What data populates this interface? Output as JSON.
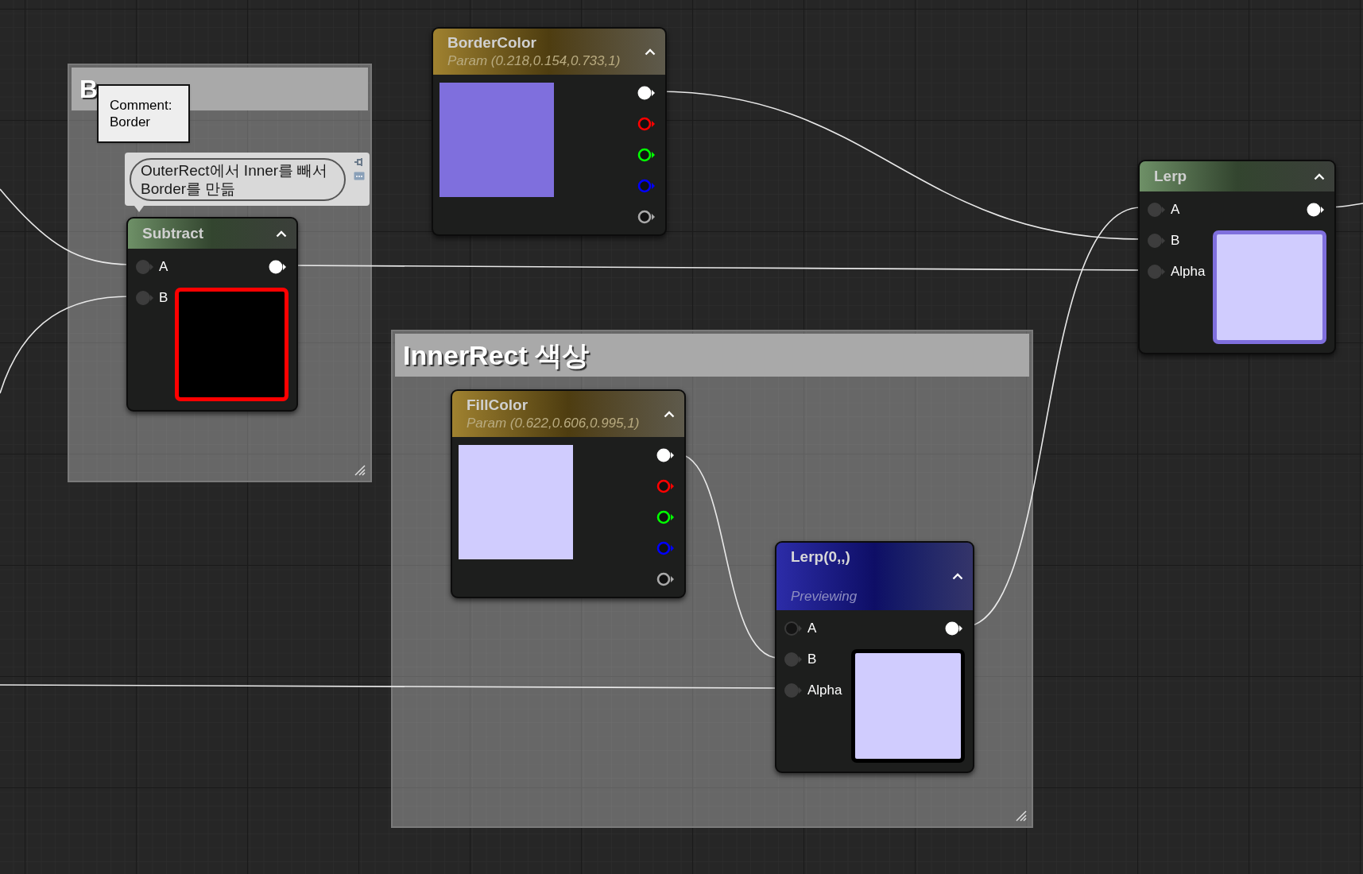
{
  "comment_boxes": [
    {
      "title": "B"
    },
    {
      "title": "InnerRect 색상"
    }
  ],
  "tooltip": {
    "text": "Comment: Border"
  },
  "node_comment": {
    "text": "OuterRect에서 Inner를 빼서 Border를 만듦"
  },
  "nodes": [
    {
      "kind": "parameter",
      "title": "BorderColor",
      "subtitle": "Param (0.218,0.154,0.733,1)",
      "outputs": [
        {
          "color": "#ffffff",
          "connected": true
        },
        {
          "color": "#ff0000",
          "connected": false
        },
        {
          "color": "#00ff00",
          "connected": false
        },
        {
          "color": "#0000ff",
          "connected": false
        },
        {
          "color": "#aaaaaa",
          "connected": false
        }
      ],
      "preview": {
        "color": "#7f6fdd"
      }
    },
    {
      "kind": "math",
      "title": "Lerp",
      "inputs": [
        {
          "label": "A",
          "connected": true
        },
        {
          "label": "B",
          "connected": true
        },
        {
          "label": "Alpha",
          "connected": true
        }
      ],
      "outputs": [
        {
          "color": "#ffffff",
          "connected": true
        }
      ],
      "preview": {
        "color": "#d0ccfe",
        "frame": {
          "color": "#7f6fdd"
        }
      }
    },
    {
      "kind": "math",
      "title": "Subtract",
      "inputs": [
        {
          "label": "A",
          "connected": true
        },
        {
          "label": "B",
          "connected": true
        }
      ],
      "outputs": [
        {
          "color": "#ffffff",
          "connected": true
        }
      ],
      "preview": {
        "color": "#000000",
        "frame": {
          "color": "#ff0000"
        }
      }
    },
    {
      "kind": "parameter",
      "title": "FillColor",
      "subtitle": "Param (0.622,0.606,0.995,1)",
      "outputs": [
        {
          "color": "#ffffff",
          "connected": true
        },
        {
          "color": "#ff0000",
          "connected": false
        },
        {
          "color": "#00ff00",
          "connected": false
        },
        {
          "color": "#0000ff",
          "connected": false
        },
        {
          "color": "#aaaaaa",
          "connected": false
        }
      ],
      "preview": {
        "color": "#d0ccfe"
      }
    },
    {
      "kind": "previewing",
      "title": "Lerp(0,,)",
      "subtitle": "Previewing",
      "inputs": [
        {
          "label": "A",
          "connected": false
        },
        {
          "label": "B",
          "connected": true
        },
        {
          "label": "Alpha",
          "connected": true
        }
      ],
      "outputs": [
        {
          "color": "#ffffff",
          "connected": true
        }
      ],
      "preview": {
        "color": "#d0ccfe",
        "frame": {
          "color": "#000000"
        }
      }
    }
  ]
}
